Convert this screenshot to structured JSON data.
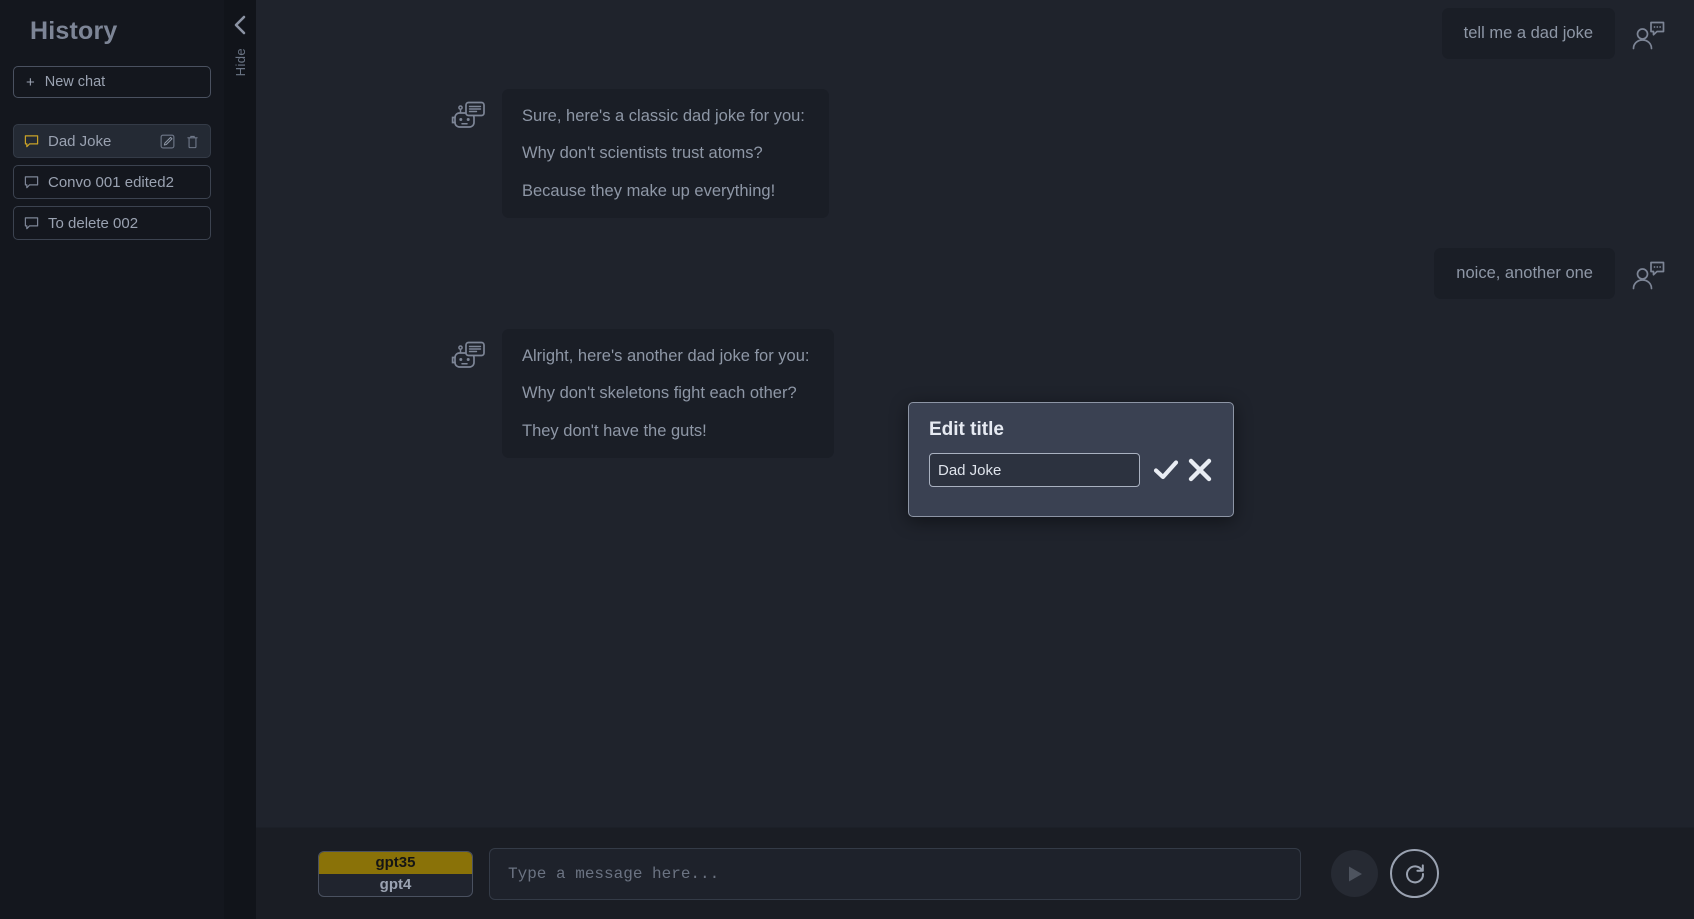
{
  "sidebar": {
    "title": "History",
    "new_chat_label": "New chat",
    "new_chat_plus": "+",
    "collapse_label": "Hide",
    "conversations": [
      {
        "label": "Dad Joke",
        "active": true,
        "icon": "chat-bubble-icon",
        "edit_icon": "edit-icon",
        "delete_icon": "trash-icon"
      },
      {
        "label": "Convo 001 edited2",
        "active": false,
        "icon": "chat-bubble-icon"
      },
      {
        "label": "To delete 002",
        "active": false,
        "icon": "chat-bubble-icon"
      }
    ]
  },
  "chat": {
    "messages": [
      {
        "role": "user",
        "avatar_icon": "user-chat-icon",
        "lines": [
          "tell me a dad joke"
        ]
      },
      {
        "role": "bot",
        "avatar_icon": "robot-chat-icon",
        "lines": [
          "Sure, here's a classic dad joke for you:",
          "Why don't scientists trust atoms?",
          "Because they make up everything!"
        ]
      },
      {
        "role": "user",
        "avatar_icon": "user-chat-icon",
        "lines": [
          "noice, another one"
        ]
      },
      {
        "role": "bot",
        "avatar_icon": "robot-chat-icon",
        "lines": [
          "Alright, here's another dad joke for you:",
          "Why don't skeletons fight each other?",
          "They don't have the guts!"
        ]
      }
    ]
  },
  "composer": {
    "models": [
      {
        "label": "gpt35",
        "selected": true
      },
      {
        "label": "gpt4",
        "selected": false
      }
    ],
    "input_value": "",
    "input_placeholder": "Type a message here...",
    "send_icon": "play-icon",
    "refresh_icon": "refresh-icon"
  },
  "modal": {
    "title": "Edit title",
    "input_value": "Dad Joke",
    "confirm_icon": "check-icon",
    "cancel_icon": "x-icon"
  },
  "colors": {
    "accent": "#8a7208",
    "sidebar_bg": "#14171e",
    "main_bg": "#1f232c",
    "bubble_bg": "#1a1e26",
    "modal_bg": "#3a4152",
    "text_muted": "#8e97a6"
  }
}
